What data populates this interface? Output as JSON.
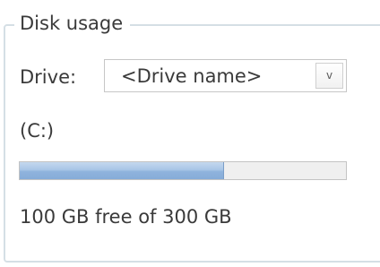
{
  "disk_usage": {
    "title": "Disk usage",
    "drive_label": "Drive:",
    "drive_select": {
      "selected_value": "<Drive name>",
      "dropdown_glyph": "v"
    },
    "drive_letter": "(C:)",
    "free_space_fraction": 0.6255,
    "usage_text": "100 GB free of 300 GB"
  },
  "colors": {
    "progress_fill": "#8fb3dd",
    "progress_track": "#efefef",
    "groupbox_border": "#d5dfe5"
  },
  "icons": {
    "dropdown": "chevron-down-icon"
  }
}
